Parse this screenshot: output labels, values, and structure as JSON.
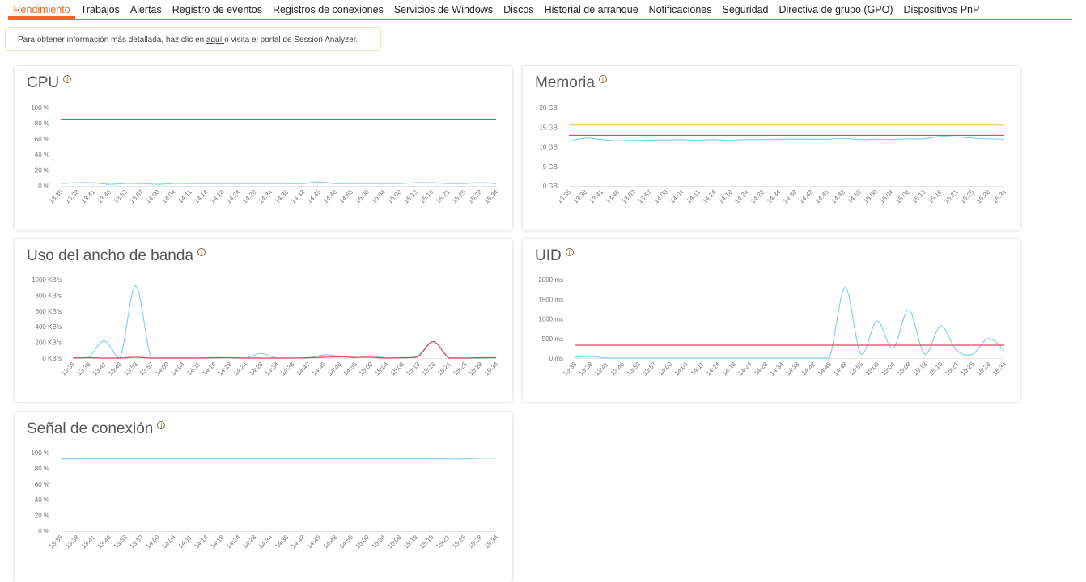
{
  "tabs": [
    {
      "label": "Rendimiento",
      "active": true
    },
    {
      "label": "Trabajos"
    },
    {
      "label": "Alertas"
    },
    {
      "label": "Registro de eventos"
    },
    {
      "label": "Registros de conexiones"
    },
    {
      "label": "Servicios de Windows"
    },
    {
      "label": "Discos"
    },
    {
      "label": "Historial de arranque"
    },
    {
      "label": "Notificaciones"
    },
    {
      "label": "Seguridad"
    },
    {
      "label": "Directiva de grupo (GPO)"
    },
    {
      "label": "Dispositivos PnP"
    }
  ],
  "info": {
    "before": "Para obtener información más detallada, haz clic en ",
    "link": "aquí ",
    "after": "o visita el portal de Session Analyzer."
  },
  "colors": {
    "accent": "#f26522",
    "series": "#7fd3ef",
    "threshold": "#e8435a",
    "limit": "#f5c350"
  },
  "info_icon": "info-circle-icon",
  "chart_data": [
    {
      "id": "cpu",
      "title": "CPU",
      "type": "line",
      "unit": "%",
      "yticks": [
        "0 %",
        "20 %",
        "40 %",
        "60 %",
        "80 %",
        "100 %"
      ],
      "ylim": [
        0,
        100
      ],
      "x": [
        "13:35",
        "13:38",
        "13:41",
        "13:46",
        "13:53",
        "13:57",
        "14:00",
        "14:04",
        "14:11",
        "14:14",
        "14:18",
        "14:24",
        "14:28",
        "14:34",
        "14:38",
        "14:42",
        "14:45",
        "14:48",
        "14:55",
        "15:00",
        "15:04",
        "15:08",
        "15:13",
        "15:16",
        "15:21",
        "15:25",
        "15:28",
        "15:34"
      ],
      "series": [
        {
          "color": "#7fd3ef",
          "values": [
            3,
            4,
            4,
            2,
            3,
            3,
            2,
            3,
            3,
            3,
            3,
            3,
            3,
            3,
            3,
            3,
            5,
            3,
            3,
            3,
            3,
            3,
            4,
            4,
            3,
            3,
            4,
            3
          ]
        },
        {
          "color": "#e8435a",
          "values": [
            85,
            85,
            85,
            85,
            85,
            85,
            85,
            85,
            85,
            85,
            85,
            85,
            85,
            85,
            85,
            85,
            85,
            85,
            85,
            85,
            85,
            85,
            85,
            85,
            85,
            85,
            85,
            85
          ]
        }
      ]
    },
    {
      "id": "memoria",
      "title": "Memoria",
      "type": "line",
      "unit": "GB",
      "yticks": [
        "0 GB",
        "5 GB",
        "10 GB",
        "15 GB",
        "20 GB"
      ],
      "ylim": [
        0,
        20
      ],
      "x": [
        "13:35",
        "13:38",
        "13:41",
        "13:46",
        "13:53",
        "13:57",
        "14:00",
        "14:04",
        "14:11",
        "14:14",
        "14:18",
        "14:24",
        "14:28",
        "14:34",
        "14:38",
        "14:42",
        "14:45",
        "14:48",
        "14:55",
        "15:00",
        "15:04",
        "15:08",
        "15:13",
        "15:16",
        "15:21",
        "15:25",
        "15:28",
        "15:34"
      ],
      "series": [
        {
          "color": "#7fd3ef",
          "values": [
            11.3,
            12.2,
            11.8,
            11.5,
            11.6,
            11.7,
            11.7,
            11.8,
            11.6,
            11.8,
            11.6,
            11.8,
            11.8,
            11.9,
            11.9,
            11.9,
            11.9,
            12.1,
            11.8,
            11.9,
            11.8,
            12.0,
            12.0,
            12.6,
            12.5,
            12.2,
            12.0,
            11.9
          ]
        },
        {
          "color": "#e8435a",
          "values": [
            12.9,
            12.9,
            12.9,
            12.9,
            12.9,
            12.9,
            12.9,
            12.9,
            12.9,
            12.9,
            12.9,
            12.9,
            12.9,
            12.9,
            12.9,
            12.9,
            12.9,
            12.9,
            12.9,
            12.9,
            12.9,
            12.9,
            12.9,
            12.9,
            12.9,
            12.9,
            12.9,
            12.9
          ]
        },
        {
          "color": "#f5c350",
          "values": [
            15.5,
            15.5,
            15.5,
            15.5,
            15.5,
            15.5,
            15.5,
            15.5,
            15.5,
            15.5,
            15.5,
            15.5,
            15.5,
            15.5,
            15.5,
            15.5,
            15.5,
            15.5,
            15.5,
            15.5,
            15.5,
            15.5,
            15.5,
            15.5,
            15.5,
            15.5,
            15.5,
            15.5
          ]
        }
      ]
    },
    {
      "id": "ancho-banda",
      "title": "Uso del ancho de banda",
      "type": "line",
      "unit": "KB/s",
      "yticks": [
        "0 KB/s",
        "200 KB/s",
        "400 KB/s",
        "600 KB/s",
        "800 KB/s",
        "1000 KB/s"
      ],
      "ylim": [
        0,
        1000
      ],
      "x": [
        "13:35",
        "13:38",
        "13:41",
        "13:46",
        "13:53",
        "13:57",
        "14:00",
        "14:04",
        "14:11",
        "14:14",
        "14:18",
        "14:24",
        "14:28",
        "14:34",
        "14:38",
        "14:42",
        "14:45",
        "14:48",
        "14:55",
        "15:00",
        "15:04",
        "15:08",
        "15:13",
        "15:16",
        "15:21",
        "15:25",
        "15:28",
        "15:34"
      ],
      "series": [
        {
          "color": "#7fd3ef",
          "values": [
            0,
            10,
            220,
            0,
            920,
            0,
            0,
            0,
            0,
            0,
            5,
            0,
            60,
            0,
            0,
            0,
            40,
            25,
            5,
            30,
            0,
            0,
            30,
            210,
            0,
            0,
            0,
            5
          ]
        },
        {
          "color": "#e8435a",
          "values": [
            0,
            5,
            0,
            0,
            10,
            0,
            0,
            0,
            0,
            5,
            5,
            0,
            0,
            0,
            0,
            5,
            10,
            15,
            10,
            10,
            0,
            5,
            15,
            210,
            0,
            0,
            5,
            5
          ]
        }
      ]
    },
    {
      "id": "uid",
      "title": "UID",
      "type": "line",
      "unit": "ms",
      "yticks": [
        "0 ms",
        "500 ms",
        "1000 ms",
        "1500 ms",
        "2000 ms"
      ],
      "ylim": [
        0,
        2000
      ],
      "x": [
        "13:35",
        "13:38",
        "13:41",
        "13:46",
        "13:53",
        "13:57",
        "14:00",
        "14:04",
        "14:11",
        "14:14",
        "14:18",
        "14:24",
        "14:28",
        "14:34",
        "14:38",
        "14:42",
        "14:45",
        "14:48",
        "14:55",
        "15:00",
        "15:04",
        "15:08",
        "15:13",
        "15:16",
        "15:21",
        "15:25",
        "15:28",
        "15:34"
      ],
      "series": [
        {
          "color": "#7fd3ef",
          "values": [
            20,
            40,
            0,
            0,
            0,
            0,
            0,
            0,
            0,
            0,
            0,
            0,
            0,
            0,
            0,
            0,
            0,
            1800,
            100,
            950,
            250,
            1230,
            100,
            820,
            200,
            100,
            500,
            200
          ]
        },
        {
          "color": "#e8435a",
          "values": [
            330,
            330,
            330,
            330,
            330,
            330,
            330,
            330,
            330,
            330,
            330,
            330,
            330,
            330,
            330,
            330,
            330,
            330,
            330,
            330,
            330,
            330,
            330,
            330,
            330,
            330,
            330,
            330
          ]
        }
      ]
    },
    {
      "id": "senal",
      "title": "Señal de conexión",
      "type": "line",
      "unit": "%",
      "yticks": [
        "0 %",
        "20 %",
        "40 %",
        "60 %",
        "80 %",
        "100 %"
      ],
      "ylim": [
        0,
        100
      ],
      "x": [
        "13:35",
        "13:38",
        "13:41",
        "13:46",
        "13:53",
        "13:57",
        "14:00",
        "14:04",
        "14:11",
        "14:14",
        "14:18",
        "14:24",
        "14:28",
        "14:34",
        "14:38",
        "14:42",
        "14:45",
        "14:48",
        "14:55",
        "15:00",
        "15:04",
        "15:08",
        "15:13",
        "15:16",
        "15:21",
        "15:25",
        "15:28",
        "15:34"
      ],
      "series": [
        {
          "color": "#7fd3ef",
          "values": [
            92,
            92,
            92,
            92,
            92,
            92,
            92,
            92,
            92,
            92,
            92,
            92,
            92,
            92,
            92,
            92,
            92,
            92,
            92,
            92,
            92,
            92,
            92,
            92,
            92,
            92,
            93,
            93
          ]
        }
      ]
    }
  ]
}
